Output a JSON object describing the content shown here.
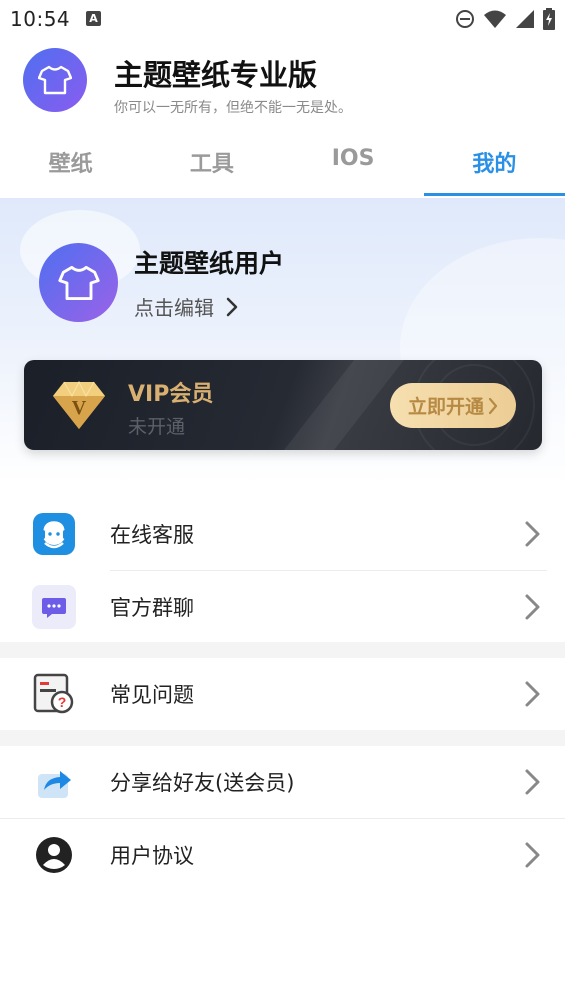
{
  "status_bar": {
    "time": "10:54",
    "notification_letter": "A",
    "icons": [
      "dnd-icon",
      "wifi-icon",
      "signal-icon",
      "battery-icon"
    ]
  },
  "header": {
    "app_title": "主题壁纸专业版",
    "slogan": "你可以一无所有，但绝不能一无是处。"
  },
  "tabs": [
    {
      "label": "壁纸",
      "active": false
    },
    {
      "label": "工具",
      "active": false
    },
    {
      "label": "IOS",
      "active": false
    },
    {
      "label": "我的",
      "active": true
    }
  ],
  "profile": {
    "username": "主题壁纸用户",
    "edit_label": "点击编辑"
  },
  "vip": {
    "title": "VIP会员",
    "status": "未开通",
    "button_label": "立即开通",
    "gem_letter": "V"
  },
  "menu": {
    "items": [
      {
        "label": "在线客服",
        "icon": "customer-service-icon"
      },
      {
        "label": "官方群聊",
        "icon": "group-chat-icon"
      },
      {
        "label": "常见问题",
        "icon": "faq-icon"
      },
      {
        "label": "分享给好友(送会员)",
        "icon": "share-icon"
      },
      {
        "label": "用户协议",
        "icon": "user-agreement-icon"
      }
    ]
  },
  "colors": {
    "accent": "#2a90e6",
    "vip_gold": "#d9b071",
    "vip_bg": "#1b1f28"
  }
}
